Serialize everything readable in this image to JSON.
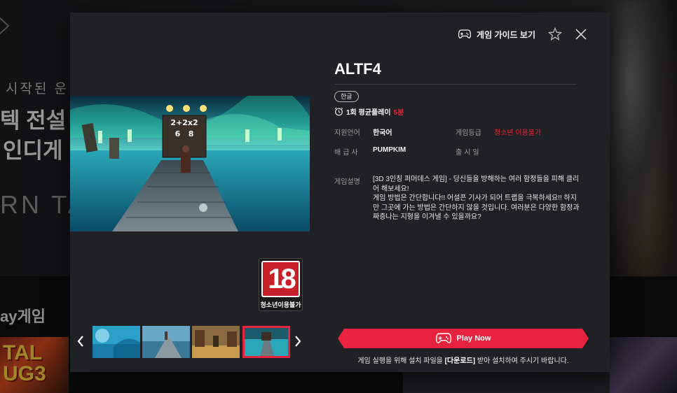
{
  "background": {
    "subtitle": "시작된 운명",
    "title_line1": "텍 전설",
    "title_line2": "인디게",
    "eng_text": "RN TA",
    "section_title": "ay게임",
    "thumb_logo": "TAL\nUG3"
  },
  "modal": {
    "guide_label": "게임 가이드 보기",
    "icons": {
      "guide": "gamepad-icon",
      "favorite": "star-icon",
      "close": "close-icon"
    },
    "game_title": "ALTF4",
    "language_badge": "한글",
    "playtime": {
      "label": "1회 평균플레이",
      "value": "5분"
    },
    "details": {
      "language_label": "지원언어",
      "language_value": "한국어",
      "rating_label": "게임등급",
      "rating_value": "청소년 이용불가",
      "publisher_label": "배급사",
      "publisher_value": "PUMPKIM",
      "release_label": "출시일"
    },
    "description_label": "게임설명",
    "description": "[3D 3인칭 퍼머데스 게임] - 당신들을 방해하는 여러 함정들을 피해 클리어 해보세요!\n게임 방법은 간단합니다!! 어설픈 기사가 되어 트랩을 극복하세요!! 하지만 그곳에 가는 방법은 간단하지 않을 것입니다. 여러분은 다양한 함정과 짜증나는 지형을 이겨낼 수 있을까요?",
    "age_rating": {
      "number": "18",
      "label": "청소년이용불가"
    },
    "screenshot_sign": "2+2x2\n6   8",
    "play_button_label": "Play Now",
    "install_note_pre": "게임 실행을 위해 설치 파일을 ",
    "install_note_bold": "[다운로드]",
    "install_note_post": " 받아 설치하여 주시기 바랍니다.",
    "accent_color": "#e8233f"
  }
}
